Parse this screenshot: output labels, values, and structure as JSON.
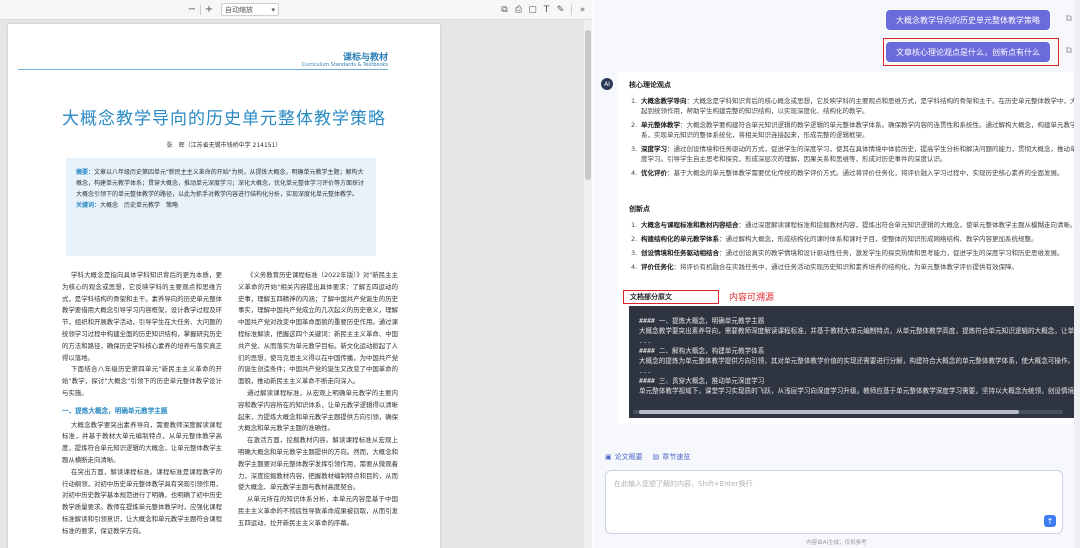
{
  "pdf_toolbar": {
    "zoom_out": "−",
    "zoom_in": "+",
    "zoom_value": "自动缩放",
    "more": "»"
  },
  "paper": {
    "journal": "课标与教材",
    "journal_en": "Curriculum Standards & Textbooks",
    "title": "大概念教学导向的历史单元整体教学策略",
    "author": "张　辉（江苏省无锡市钱桥中学 214151）",
    "abstract_label": "摘要：",
    "abstract": "文章以八年级历史第四单元\"新民主主义革命的开始\"为例，从提炼大概念，明确单元教学主题；解构大概念，构建单元教学体系；贯穿大概念，推动单元深度学习；深化大概念，优化单元整体学习评价等方面探讨大概念引领下的单元整体教学的路径，以此为抓手对教学内容进行结构化分析，实现深度化单元整体教学。",
    "keywords_label": "关键词：",
    "keywords": "大概念　历史单元教学　策略",
    "col_left": [
      "学科大概念是指向具体学科知识背后的更为本质，更为核心的观念或思想，它反映学科的主要观点和思维方式，是学科结构的骨架和主干。素养导向的历史单元整体教学要借用大概念引导学习内容框架，设计教学过程及环节，组织和开展教学活动，引导学生在大任务、大问题的统领学习过程中构建全面的历史知识结构，掌握研究历史的方法和路径，确保历史学科核心素养的培养与落实真正得以落地。",
      "下面结合八年级历史第四单元\"新民主主义革命的开始\"教学，探讨\"大概念\"引领下的历史单元整体教学设计与实施。"
    ],
    "col_left_heading": "一、提炼大概念，明确单元教学主题",
    "col_left_after": [
      "大概念教学要突出素养导向，需要教师深度解读课程标准，并基于教材大单元编制特点，从单元整体教学高度，提炼符合单元知识逻辑的大概念，让单元整体教学主题从横断走向清晰。",
      "在突出方面，解读课程标准。课程标准是课程教学的行动纲领，对初中历史单元整体教学具有突现引领作用，对初中历史教学基本规范进行了明确，也明确了初中历史教学质量要求。教师在提炼单元整体教学时，应强化课程标准解读和引领意识，让大概念和单元教学主题符合课程标准的要求，保证教学方向。"
    ],
    "col_right": [
      "《义务教育历史课程标准（2022年版）》对\"新民主主义革命的开始\"相关内容提出具体要求：了解五四运动的史事，理解五四精神的内涵；了解中国共产党诞生的历史事实，理解中国共产党成立的几次起义的历史意义，理解中国共产党对改变中国革命面貌的重要历史作用。通过课程标准解读，把握这四个关键词：新民主主义革命、中国共产党、从而落实为单元教学目标。新文化运动掀起了人们的思想，使马克思主义得以在中国传播，为中国共产党的诞生创造条件；中国共产党的诞生又改变了中国革命的面貌，推动新民主主义革命不断走向深入。",
      "通过解读课程标准，从宏观上明确单元教学的主要内容和教学内容所在的知识体系，让单元教学逻辑得以清晰起来，为提炼大概念和单元教学主题提供方向引领，确保大概念和单元教学主题的准确性。",
      "在激活方面，挖掘教材内容。解读课程标准从宏观上明确大概念和单元教学主题提供的方向。然而，大概念和教学主题要对单元整体教学发挥引领作用，需要从微观着力，深度挖掘教材内容，把握教材编制特点和目的，从而使大概念、单元教学主题与教材高度契合。",
      "从单元所在的知识体系分析，本单元内容是基于中国民主主义革命的不彻底性导致革命成果被窃取，从而引发五四运动，拉开新民主主义革命的序幕。"
    ]
  },
  "chat": {
    "user_messages": [
      "大概念教学导向的历史单元整体教学策略",
      "文章核心理论观点是什么，创新点有什么"
    ],
    "avatar_label": "AI",
    "section1_title": "核心理论观点",
    "section1_items": [
      {
        "n": "1.",
        "term": "大概念教学导向",
        "sep": "：",
        "text": "大概念是学科知识背后的核心概念或思想，它反映学科的主要观点和思维方式，是学科结构的骨架和主干。在历史单元整体教学中，大概念起到统领作用，帮助学生构建完整的知识结构，以实现深度化、结构化的教学。"
      },
      {
        "n": "2.",
        "term": "单元整体教学",
        "sep": "：",
        "text": "大概念教学要构建符合单元知识逻辑的教学逻辑的单元整体教学体系。确保教学内容的连贯性和系统性。通过解构大概念，构建单元教学体系，实现单元知识的整体系统化，将相关知识连接起来，形成完整的逻辑框架。"
      },
      {
        "n": "3.",
        "term": "深度学习",
        "sep": "：",
        "text": "通过创设情境和任务驱动的方式，促进学生的深度学习，使其在具体情境中体验历史，提高学生分析和解决问题的能力，贯彻大概念，推动单元深度学习。引导学生自主思考和探究，形成深层次的理解，因果关系和思维等，形成对历史事件的深度认识。"
      },
      {
        "n": "4.",
        "term": "优化评价",
        "sep": "：",
        "text": "基于大概念的单元整体教学需要优化传统的教学评价方式。通过将评价任务化，将评价融入学习过程中，实现历史核心素养的全面发展。"
      }
    ],
    "section2_title": "创新点",
    "section2_items": [
      {
        "n": "1.",
        "term": "大概念与课程标准和教材内容结合",
        "sep": "：",
        "text": "通过深度解读课程标准和挖掘教材内容，提炼出符合单元知识逻辑的大概念，使单元整体教学主题从模糊走向清晰。"
      },
      {
        "n": "2.",
        "term": "构建结构化的单元教学体系",
        "sep": "：",
        "text": "通过解构大概念，形成结构化的课时体系和课时子目，使整体的知识形成网络结构、教学内容更加系统规整。"
      },
      {
        "n": "3.",
        "term": "创设情境和任务驱动相结合",
        "sep": "：",
        "text": "通过创设真实的教学情境和设计驱动性任务，激发学生的探究热情和思考能力，促进学生的深度学习和历史思维发展。"
      },
      {
        "n": "4.",
        "term": "评价任务化",
        "sep": "：",
        "text": "将评价有机融合在实践任务中，通过任务活动实现历史知识和素养培养的结构化，为单元整体教学评价提供有效保障。"
      }
    ],
    "source_tag": "文档部分原文",
    "source_note": "内容可溯源",
    "code_lines": [
      "#### 一、提炼大概念，明确单元教学主题",
      "大概念教学要突出素养导向，需要教师深度解读课程标准，并基于教材大单元编制特点，从单元整体教学高度，提炼符合单元知识逻辑的大概念，让单元整体教学主题从模糊",
      "...",
      "#### 二、解构大概念，构建单元教学体系",
      "大概念的提炼为单元整体教学提供方向引领，其对单元整体教学价值的实现还需要进行分解，构建符合大概念的单元整体教学体系，使大概念可操作。",
      "...",
      "#### 三、贯穿大概念，推动单元深度学习",
      "单元整体教学视域下，课堂学习实现质的飞跃，从浅层学习向深度学习升级。教师应基于单元整体教学深度学习需要，坚持以大概念为统领，创设情境，设计任务，引导学生深度学习"
    ],
    "tabs": [
      {
        "icon": "▣",
        "label": "论文概要"
      },
      {
        "icon": "▤",
        "label": "章节速览"
      }
    ],
    "input_placeholder": "在此输入您想了解的内容，Shift+Enter换行",
    "send_icon": "↑",
    "disclaimer": "内容由AI生成，仅供参考"
  }
}
